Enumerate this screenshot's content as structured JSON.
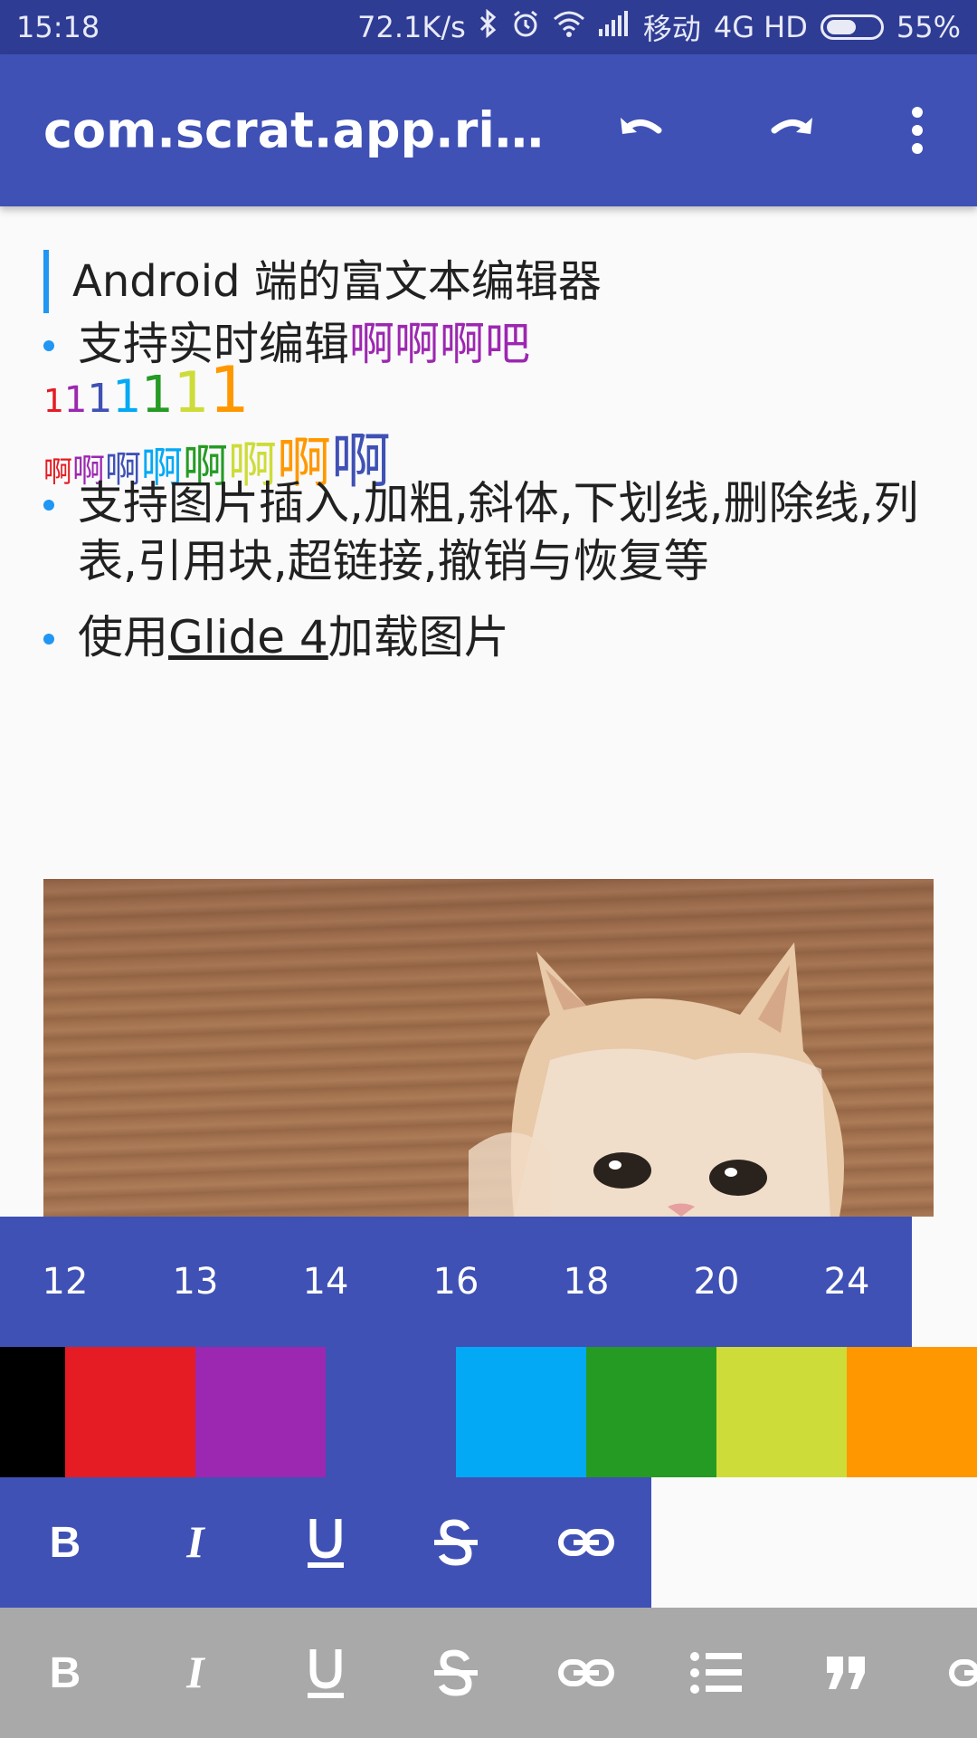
{
  "status_bar": {
    "time": "15:18",
    "speed": "72.1K/s",
    "carrier": "移动",
    "network": "4G HD",
    "battery_percent": "55%",
    "battery_level": 0.55
  },
  "app_bar": {
    "title": "com.scrat.app.rich…",
    "actions": [
      "undo-icon",
      "redo-icon",
      "more-vert-icon"
    ]
  },
  "editor": {
    "quote": "Android 端的富文本编辑器",
    "bullet1": {
      "text": "支持实时编辑",
      "highlight": "啊啊啊吧",
      "highlight_color": "#9c27b0"
    },
    "digits": [
      {
        "char": "1",
        "color": "#e51c23",
        "size": 36
      },
      {
        "char": "1",
        "color": "#9c27b0",
        "size": 40
      },
      {
        "char": "1",
        "color": "#3f51b5",
        "size": 44
      },
      {
        "char": "1",
        "color": "#03a9f4",
        "size": 50
      },
      {
        "char": "1",
        "color": "#259b24",
        "size": 56
      },
      {
        "char": "1",
        "color": "#cddc39",
        "size": 62
      },
      {
        "char": "1",
        "color": "#ff9800",
        "size": 70
      }
    ],
    "ah_chars": [
      {
        "char": "啊",
        "color": "#e51c23",
        "size": 32
      },
      {
        "char": "啊",
        "color": "#9c27b0",
        "size": 36
      },
      {
        "char": "啊",
        "color": "#3f51b5",
        "size": 40
      },
      {
        "char": "啊",
        "color": "#03a9f4",
        "size": 46
      },
      {
        "char": "啊",
        "color": "#259b24",
        "size": 50
      },
      {
        "char": "啊",
        "color": "#cddc39",
        "size": 54
      },
      {
        "char": "啊",
        "color": "#ff9800",
        "size": 60
      },
      {
        "char": "啊",
        "color": "#3f51b5",
        "size": 66
      }
    ],
    "bullet2": "支持图片插入,加粗,斜体,下划线,删除线,列表,引用块,超链接,撤销与恢复等",
    "bullet3": {
      "prefix": "使用",
      "link": "Glide 4",
      "suffix": "加载图片"
    }
  },
  "font_sizes": [
    "12",
    "13",
    "14",
    "16",
    "18",
    "20",
    "24"
  ],
  "colors": [
    "#000000",
    "#e51c23",
    "#9c27b0",
    "#3f51b5",
    "#03a9f4",
    "#259b24",
    "#cddc39",
    "#ff9800"
  ],
  "style_toolbar": [
    "bold-icon",
    "italic-icon",
    "underline-icon",
    "strikethrough-icon",
    "link-icon"
  ],
  "bottom_toolbar": [
    "bold-icon",
    "italic-icon",
    "underline-icon",
    "strikethrough-icon",
    "link-icon",
    "list-icon",
    "quote-icon",
    "link-icon"
  ]
}
